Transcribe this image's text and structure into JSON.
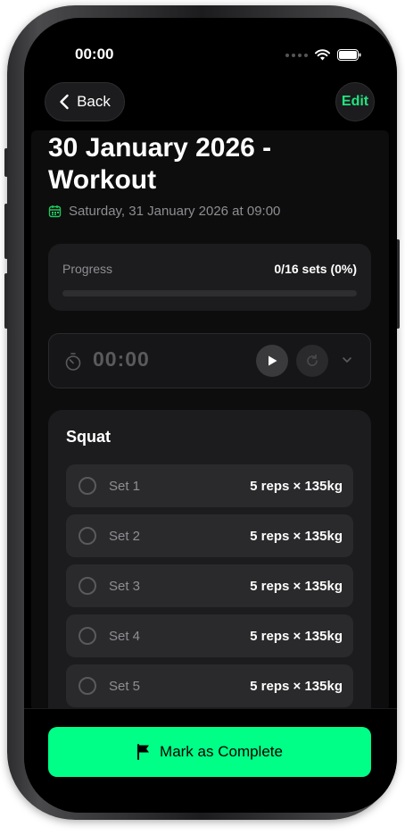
{
  "status_bar": {
    "time": "00:00"
  },
  "nav": {
    "back_label": "Back",
    "edit_label": "Edit"
  },
  "workout": {
    "title": "30 January 2026 - Workout",
    "scheduled": "Saturday, 31 January 2026 at 09:00"
  },
  "progress": {
    "label": "Progress",
    "value_text": "0/16 sets (0%)",
    "fraction": 0
  },
  "timer": {
    "display": "00:00"
  },
  "exercise": {
    "name": "Squat",
    "sets": [
      {
        "label": "Set 1",
        "detail": "5 reps × 135kg"
      },
      {
        "label": "Set 2",
        "detail": "5 reps × 135kg"
      },
      {
        "label": "Set 3",
        "detail": "5 reps × 135kg"
      },
      {
        "label": "Set 4",
        "detail": "5 reps × 135kg"
      },
      {
        "label": "Set 5",
        "detail": "5 reps × 135kg"
      }
    ]
  },
  "footer": {
    "complete_label": "Mark as Complete"
  },
  "colors": {
    "accent": "#00ff87",
    "edit_text": "#22e37f",
    "background": "#000000",
    "card": "#1c1c1e"
  },
  "icons": [
    "chevron-left-icon",
    "calendar-icon",
    "timer-icon",
    "play-icon",
    "reset-icon",
    "chevron-down-icon",
    "flag-icon",
    "wifi-icon",
    "battery-icon",
    "cellular-icon"
  ]
}
